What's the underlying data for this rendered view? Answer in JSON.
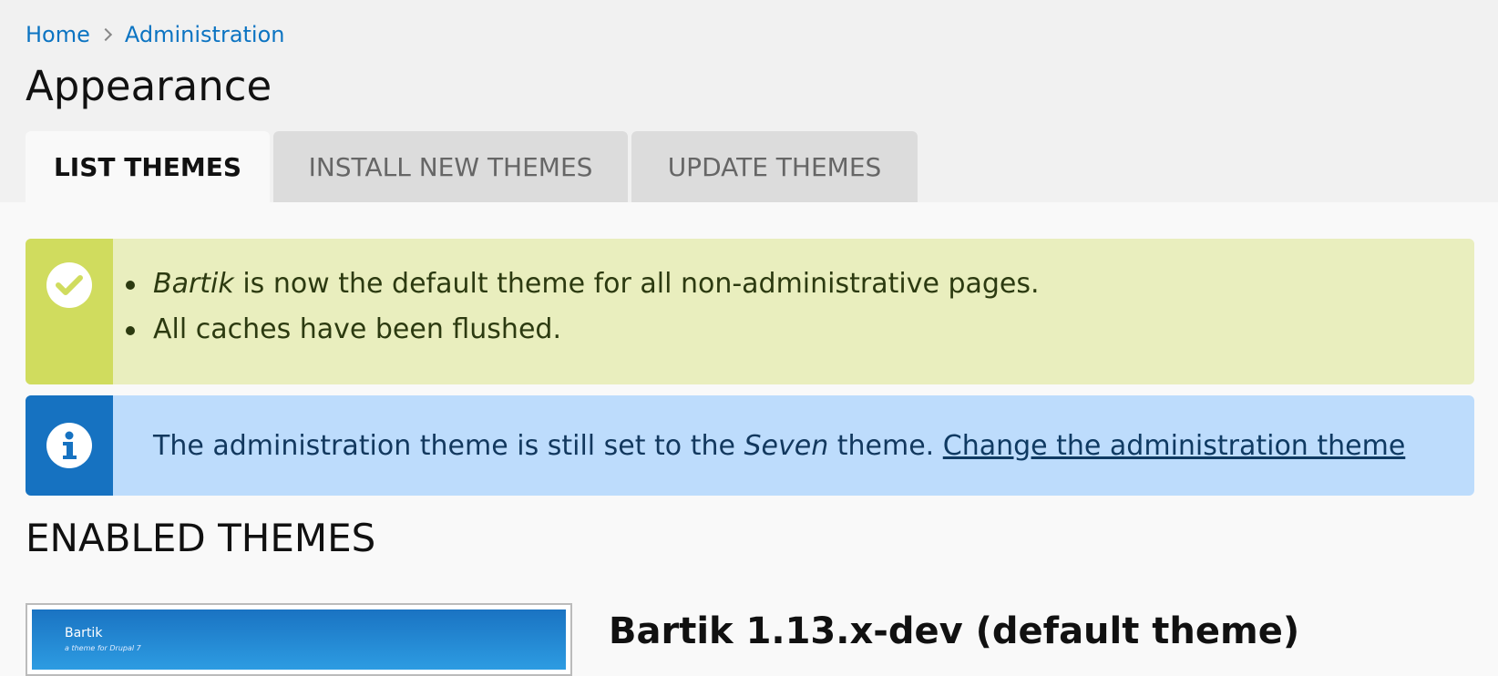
{
  "breadcrumb": {
    "items": [
      {
        "label": "Home"
      },
      {
        "label": "Administration"
      }
    ]
  },
  "page": {
    "title": "Appearance"
  },
  "tabs": [
    {
      "label": "LIST THEMES",
      "active": true
    },
    {
      "label": "INSTALL NEW THEMES",
      "active": false
    },
    {
      "label": "UPDATE THEMES",
      "active": false
    }
  ],
  "status_message": {
    "items": [
      {
        "emph": "Bartik",
        "text": " is now the default theme for all non-administrative pages."
      },
      {
        "text": "All caches have been flushed."
      }
    ]
  },
  "info_message": {
    "text_before": "The administration theme is still set to the ",
    "emph": "Seven",
    "text_after": " theme. ",
    "link_label": "Change the administration theme"
  },
  "enabled_themes": {
    "heading": "ENABLED THEMES",
    "themes": [
      {
        "name": "Bartik 1.13.x-dev (default theme)",
        "screenshot_title": "Bartik",
        "screenshot_slogan": "a theme for Drupal 7"
      }
    ]
  },
  "colors": {
    "link": "#0c74c2",
    "status_bg": "#e9eebe",
    "status_accent": "#d0dc5e",
    "info_bg": "#bddcfc",
    "info_accent": "#1672c1"
  }
}
